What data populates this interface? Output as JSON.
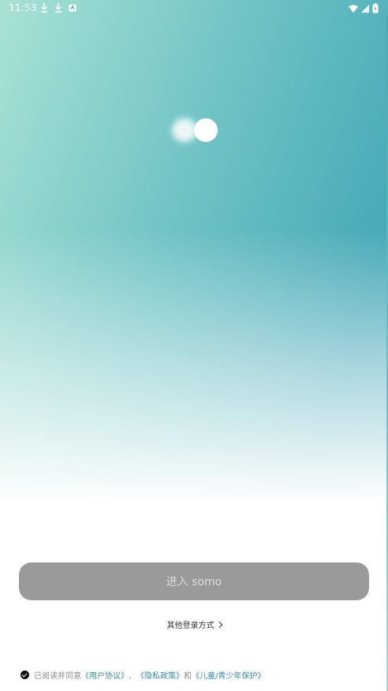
{
  "status_bar": {
    "time": "11:53",
    "left_icons": [
      "download-icon",
      "download-icon",
      "app-notification-icon"
    ],
    "right_icons": [
      "wifi-icon",
      "signal-icon",
      "battery-charging-icon"
    ]
  },
  "logo": {
    "name": "somo-logo"
  },
  "enter_button": {
    "label": "进入 somo"
  },
  "other_login": {
    "label": "其他登录方式"
  },
  "agreement": {
    "checked": true,
    "prefix": "已阅读并同意",
    "user_agreement": "《用户协议》",
    "separator": "、",
    "privacy_policy": "《隐私政策》",
    "and": "和",
    "child_protection": "《儿童/青少年保护》"
  },
  "colors": {
    "accent": "#3a8aa7",
    "button_bg": "#9a9a9a",
    "gradient_start": "#a9e2d5",
    "gradient_end": "#46a8b8"
  }
}
